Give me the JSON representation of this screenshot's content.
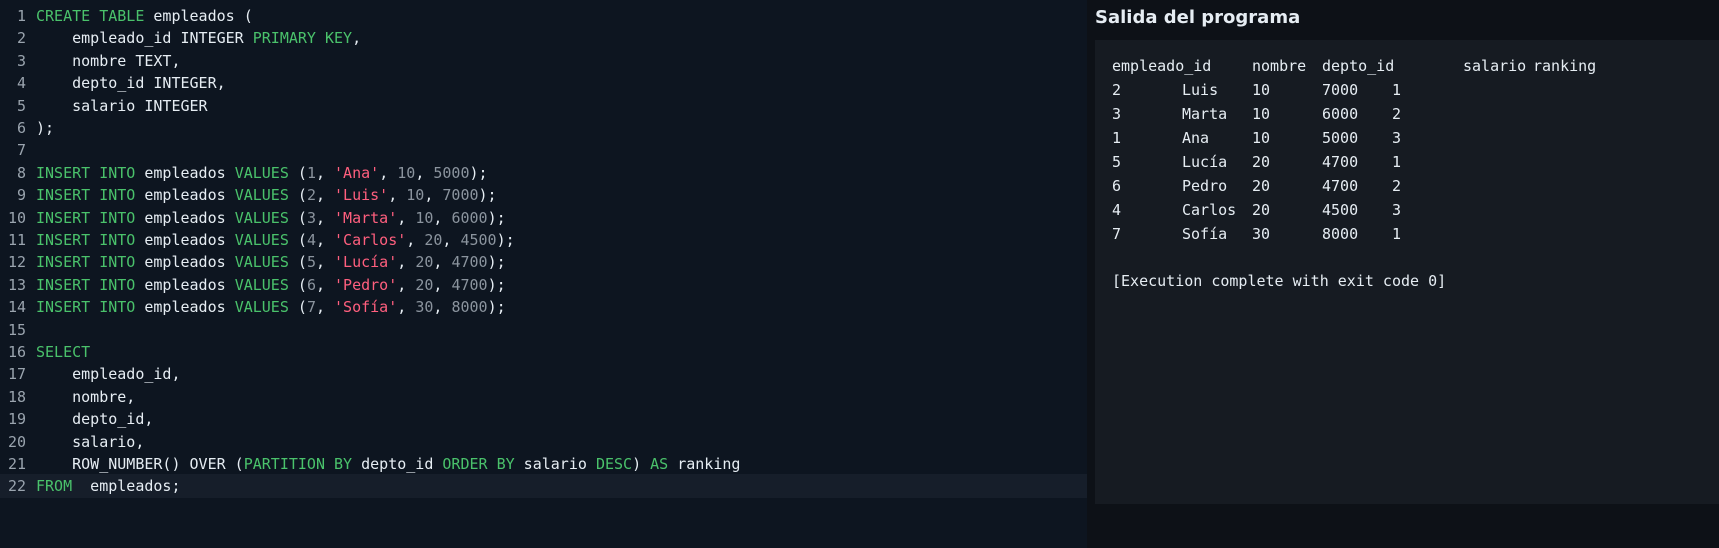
{
  "editor": {
    "lines": [
      {
        "num": "1",
        "tokens": [
          {
            "t": "CREATE TABLE",
            "c": "kw"
          },
          {
            "t": " empleados (",
            "c": "id"
          }
        ]
      },
      {
        "num": "2",
        "tokens": [
          {
            "t": "    empleado_id INTEGER ",
            "c": "id"
          },
          {
            "t": "PRIMARY KEY",
            "c": "kw"
          },
          {
            "t": ",",
            "c": "id"
          }
        ]
      },
      {
        "num": "3",
        "tokens": [
          {
            "t": "    nombre TEXT,",
            "c": "id"
          }
        ]
      },
      {
        "num": "4",
        "tokens": [
          {
            "t": "    depto_id INTEGER,",
            "c": "id"
          }
        ]
      },
      {
        "num": "5",
        "tokens": [
          {
            "t": "    salario INTEGER",
            "c": "id"
          }
        ]
      },
      {
        "num": "6",
        "tokens": [
          {
            "t": ");",
            "c": "id"
          }
        ]
      },
      {
        "num": "7",
        "tokens": []
      },
      {
        "num": "8",
        "tokens": [
          {
            "t": "INSERT INTO",
            "c": "kw"
          },
          {
            "t": " empleados ",
            "c": "id"
          },
          {
            "t": "VALUES",
            "c": "kw"
          },
          {
            "t": " (",
            "c": "id"
          },
          {
            "t": "1",
            "c": "num"
          },
          {
            "t": ", ",
            "c": "id"
          },
          {
            "t": "'Ana'",
            "c": "str"
          },
          {
            "t": ", ",
            "c": "id"
          },
          {
            "t": "10",
            "c": "num"
          },
          {
            "t": ", ",
            "c": "id"
          },
          {
            "t": "5000",
            "c": "num"
          },
          {
            "t": ");",
            "c": "id"
          }
        ]
      },
      {
        "num": "9",
        "tokens": [
          {
            "t": "INSERT INTO",
            "c": "kw"
          },
          {
            "t": " empleados ",
            "c": "id"
          },
          {
            "t": "VALUES",
            "c": "kw"
          },
          {
            "t": " (",
            "c": "id"
          },
          {
            "t": "2",
            "c": "num"
          },
          {
            "t": ", ",
            "c": "id"
          },
          {
            "t": "'Luis'",
            "c": "str"
          },
          {
            "t": ", ",
            "c": "id"
          },
          {
            "t": "10",
            "c": "num"
          },
          {
            "t": ", ",
            "c": "id"
          },
          {
            "t": "7000",
            "c": "num"
          },
          {
            "t": ");",
            "c": "id"
          }
        ]
      },
      {
        "num": "10",
        "tokens": [
          {
            "t": "INSERT INTO",
            "c": "kw"
          },
          {
            "t": " empleados ",
            "c": "id"
          },
          {
            "t": "VALUES",
            "c": "kw"
          },
          {
            "t": " (",
            "c": "id"
          },
          {
            "t": "3",
            "c": "num"
          },
          {
            "t": ", ",
            "c": "id"
          },
          {
            "t": "'Marta'",
            "c": "str"
          },
          {
            "t": ", ",
            "c": "id"
          },
          {
            "t": "10",
            "c": "num"
          },
          {
            "t": ", ",
            "c": "id"
          },
          {
            "t": "6000",
            "c": "num"
          },
          {
            "t": ");",
            "c": "id"
          }
        ]
      },
      {
        "num": "11",
        "tokens": [
          {
            "t": "INSERT INTO",
            "c": "kw"
          },
          {
            "t": " empleados ",
            "c": "id"
          },
          {
            "t": "VALUES",
            "c": "kw"
          },
          {
            "t": " (",
            "c": "id"
          },
          {
            "t": "4",
            "c": "num"
          },
          {
            "t": ", ",
            "c": "id"
          },
          {
            "t": "'Carlos'",
            "c": "str"
          },
          {
            "t": ", ",
            "c": "id"
          },
          {
            "t": "20",
            "c": "num"
          },
          {
            "t": ", ",
            "c": "id"
          },
          {
            "t": "4500",
            "c": "num"
          },
          {
            "t": ");",
            "c": "id"
          }
        ]
      },
      {
        "num": "12",
        "tokens": [
          {
            "t": "INSERT INTO",
            "c": "kw"
          },
          {
            "t": " empleados ",
            "c": "id"
          },
          {
            "t": "VALUES",
            "c": "kw"
          },
          {
            "t": " (",
            "c": "id"
          },
          {
            "t": "5",
            "c": "num"
          },
          {
            "t": ", ",
            "c": "id"
          },
          {
            "t": "'Lucía'",
            "c": "str"
          },
          {
            "t": ", ",
            "c": "id"
          },
          {
            "t": "20",
            "c": "num"
          },
          {
            "t": ", ",
            "c": "id"
          },
          {
            "t": "4700",
            "c": "num"
          },
          {
            "t": ");",
            "c": "id"
          }
        ]
      },
      {
        "num": "13",
        "tokens": [
          {
            "t": "INSERT INTO",
            "c": "kw"
          },
          {
            "t": " empleados ",
            "c": "id"
          },
          {
            "t": "VALUES",
            "c": "kw"
          },
          {
            "t": " (",
            "c": "id"
          },
          {
            "t": "6",
            "c": "num"
          },
          {
            "t": ", ",
            "c": "id"
          },
          {
            "t": "'Pedro'",
            "c": "str"
          },
          {
            "t": ", ",
            "c": "id"
          },
          {
            "t": "20",
            "c": "num"
          },
          {
            "t": ", ",
            "c": "id"
          },
          {
            "t": "4700",
            "c": "num"
          },
          {
            "t": ");",
            "c": "id"
          }
        ]
      },
      {
        "num": "14",
        "tokens": [
          {
            "t": "INSERT INTO",
            "c": "kw"
          },
          {
            "t": " empleados ",
            "c": "id"
          },
          {
            "t": "VALUES",
            "c": "kw"
          },
          {
            "t": " (",
            "c": "id"
          },
          {
            "t": "7",
            "c": "num"
          },
          {
            "t": ", ",
            "c": "id"
          },
          {
            "t": "'Sofía'",
            "c": "str"
          },
          {
            "t": ", ",
            "c": "id"
          },
          {
            "t": "30",
            "c": "num"
          },
          {
            "t": ", ",
            "c": "id"
          },
          {
            "t": "8000",
            "c": "num"
          },
          {
            "t": ");",
            "c": "id"
          }
        ]
      },
      {
        "num": "15",
        "tokens": []
      },
      {
        "num": "16",
        "tokens": [
          {
            "t": "SELECT",
            "c": "kw"
          }
        ]
      },
      {
        "num": "17",
        "tokens": [
          {
            "t": "    empleado_id,",
            "c": "id"
          }
        ]
      },
      {
        "num": "18",
        "tokens": [
          {
            "t": "    nombre,",
            "c": "id"
          }
        ]
      },
      {
        "num": "19",
        "tokens": [
          {
            "t": "    depto_id,",
            "c": "id"
          }
        ]
      },
      {
        "num": "20",
        "tokens": [
          {
            "t": "    salario,",
            "c": "id"
          }
        ]
      },
      {
        "num": "21",
        "tokens": [
          {
            "t": "    ROW_NUMBER() OVER (",
            "c": "id"
          },
          {
            "t": "PARTITION BY",
            "c": "kw"
          },
          {
            "t": " depto_id ",
            "c": "id"
          },
          {
            "t": "ORDER BY",
            "c": "kw"
          },
          {
            "t": " salario ",
            "c": "id"
          },
          {
            "t": "DESC",
            "c": "kw"
          },
          {
            "t": ") ",
            "c": "id"
          },
          {
            "t": "AS",
            "c": "kw"
          },
          {
            "t": " ranking",
            "c": "id"
          }
        ]
      },
      {
        "num": "22",
        "tokens": [
          {
            "t": "FROM",
            "c": "kw"
          },
          {
            "t": "  empleados;",
            "c": "id"
          }
        ]
      }
    ]
  },
  "output": {
    "title": "Salida del programa",
    "headers": [
      "empleado_id",
      "nombre",
      "depto_id",
      "salario",
      "ranking"
    ],
    "rows": [
      [
        "2",
        "Luis",
        "10",
        "7000",
        "1"
      ],
      [
        "3",
        "Marta",
        "10",
        "6000",
        "2"
      ],
      [
        "1",
        "Ana",
        "10",
        "5000",
        "3"
      ],
      [
        "5",
        "Lucía",
        "20",
        "4700",
        "1"
      ],
      [
        "6",
        "Pedro",
        "20",
        "4700",
        "2"
      ],
      [
        "4",
        "Carlos",
        "20",
        "4500",
        "3"
      ],
      [
        "7",
        "Sofía",
        "30",
        "8000",
        "1"
      ]
    ],
    "status": "[Execution complete with exit code 0]"
  },
  "colors": {
    "keyword": "#4ac26b",
    "string": "#ff5f7e",
    "number": "#8b949e",
    "text": "#e6edf3",
    "editor_bg": "#0d1520",
    "output_bg": "#161b22"
  }
}
